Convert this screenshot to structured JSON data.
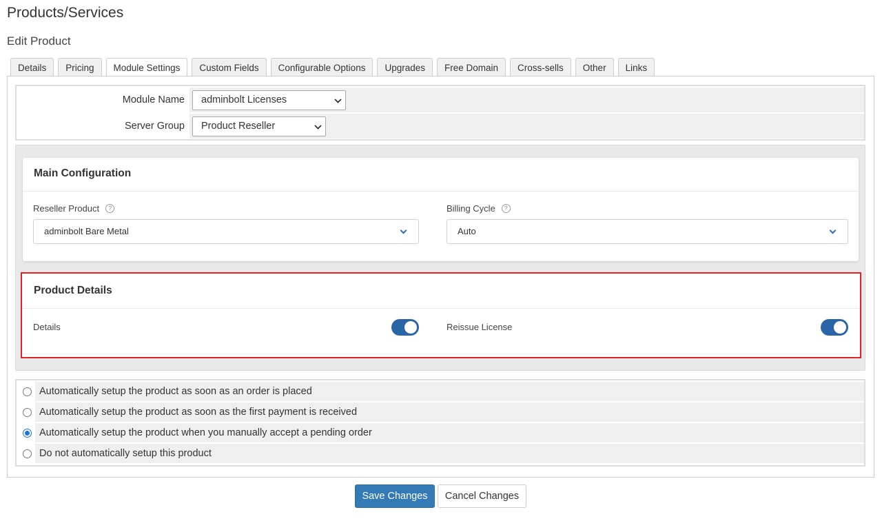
{
  "page": {
    "title": "Products/Services",
    "subtitle": "Edit Product"
  },
  "tabs": [
    {
      "label": "Details"
    },
    {
      "label": "Pricing"
    },
    {
      "label": "Module Settings",
      "active": true
    },
    {
      "label": "Custom Fields"
    },
    {
      "label": "Configurable Options"
    },
    {
      "label": "Upgrades"
    },
    {
      "label": "Free Domain"
    },
    {
      "label": "Cross-sells"
    },
    {
      "label": "Other"
    },
    {
      "label": "Links"
    }
  ],
  "module_form": {
    "module_name_label": "Module Name",
    "module_name_value": "adminbolt Licenses",
    "server_group_label": "Server Group",
    "server_group_value": "Product Reseller"
  },
  "main_config": {
    "title": "Main Configuration",
    "reseller_product_label": "Reseller Product",
    "reseller_product_value": "adminbolt Bare Metal",
    "billing_cycle_label": "Billing Cycle",
    "billing_cycle_value": "Auto",
    "help_glyph": "?"
  },
  "product_details": {
    "title": "Product Details",
    "details_label": "Details",
    "details_enabled": true,
    "reissue_label": "Reissue License",
    "reissue_enabled": true
  },
  "setup_options": [
    {
      "label": "Automatically setup the product as soon as an order is placed",
      "checked": false
    },
    {
      "label": "Automatically setup the product as soon as the first payment is received",
      "checked": false
    },
    {
      "label": "Automatically setup the product when you manually accept a pending order",
      "checked": true
    },
    {
      "label": "Do not automatically setup this product",
      "checked": false
    }
  ],
  "actions": {
    "save_label": "Save Changes",
    "cancel_label": "Cancel Changes"
  },
  "colors": {
    "primary": "#337ab7",
    "toggle_on": "#2a66a7",
    "highlight_border": "#e0202a"
  }
}
